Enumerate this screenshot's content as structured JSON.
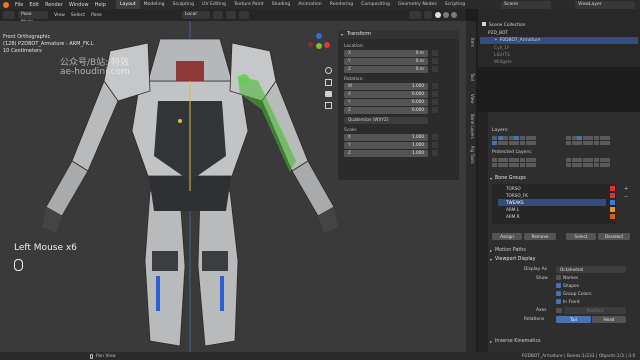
{
  "menu": [
    "File",
    "Edit",
    "Render",
    "Window",
    "Help"
  ],
  "workspaces": [
    "Layout",
    "Modeling",
    "Sculpting",
    "UV Editing",
    "Texture Paint",
    "Shading",
    "Animation",
    "Rendering",
    "Compositing",
    "Geometry Nodes",
    "Scripting"
  ],
  "scene": {
    "label": "Scene",
    "viewlayer": "ViewLayer"
  },
  "vp_header": {
    "mode": "Pose Mode",
    "view": "View",
    "select": "Select",
    "pose": "Pose",
    "orientation": "Local",
    "pose_options": "Pose Options"
  },
  "viewport": {
    "title": "Front Orthographic",
    "object": "(128) P2DBOT_Armature : ARM_FK.L",
    "scale": "10 Centimeters",
    "key_hint": "Left Mouse x6",
    "watermark1": "公众号/B站: 特效",
    "watermark2": "ae-houdini.com"
  },
  "npanel": {
    "transform": "Transform",
    "location": "Location:",
    "loc": [
      {
        "axis": "X",
        "val": "0 m"
      },
      {
        "axis": "Y",
        "val": "0 m"
      },
      {
        "axis": "Z",
        "val": "0 m"
      }
    ],
    "rotation": "Rotation:",
    "rot": [
      {
        "axis": "W",
        "val": "1.000"
      },
      {
        "axis": "X",
        "val": "0.000"
      },
      {
        "axis": "Y",
        "val": "0.000"
      },
      {
        "axis": "Z",
        "val": "0.000"
      }
    ],
    "rot_mode": "Quaternion (WXYZ)",
    "scale_label": "Scale:",
    "scl": [
      {
        "axis": "X",
        "val": "1.000"
      },
      {
        "axis": "Y",
        "val": "1.000"
      },
      {
        "axis": "Z",
        "val": "1.000"
      }
    ]
  },
  "sidetabs": [
    "Item",
    "Tool",
    "View",
    "Bone Layers",
    "Rig Tools"
  ],
  "outliner": {
    "header": "Scene Collection",
    "rows": [
      "P2D_BOT",
      "P2DBOT_Armature",
      "Cyli_1F",
      "LIGHTS",
      "Widgets"
    ]
  },
  "props": {
    "layers": "Layers:",
    "protected": "Protected Layers:",
    "bone_groups": "Bone Groups",
    "groups": [
      {
        "name": "TORSO",
        "color": "#e03030"
      },
      {
        "name": "TORSO_FK",
        "color": "#e03030"
      },
      {
        "name": "TWEAKS",
        "color": "#3a7bd5"
      },
      {
        "name": "ARM.L",
        "color": "#e89a20"
      },
      {
        "name": "ARM.R",
        "color": "#e05a1a"
      }
    ],
    "assign": "Assign",
    "remove": "Remove",
    "select": "Select",
    "deselect": "Deselect",
    "motion_paths": "Motion Paths",
    "viewport_display": "Viewport Display",
    "display_as_label": "Display As",
    "display_as": "Octahedral",
    "show_label": "Show",
    "names": "Names",
    "shapes": "Shapes",
    "group_colors": "Group Colors",
    "in_front": "In Front",
    "axes_label": "Axes",
    "axes_val": "Position",
    "relations_label": "Relations",
    "tail": "Tail",
    "head": "Head",
    "ik": "Inverse Kinematics"
  },
  "status": {
    "left": "Pan View",
    "right": "P2DBOT_Armature | Bones:1/233 | Objects:1/3 | 3.0"
  }
}
